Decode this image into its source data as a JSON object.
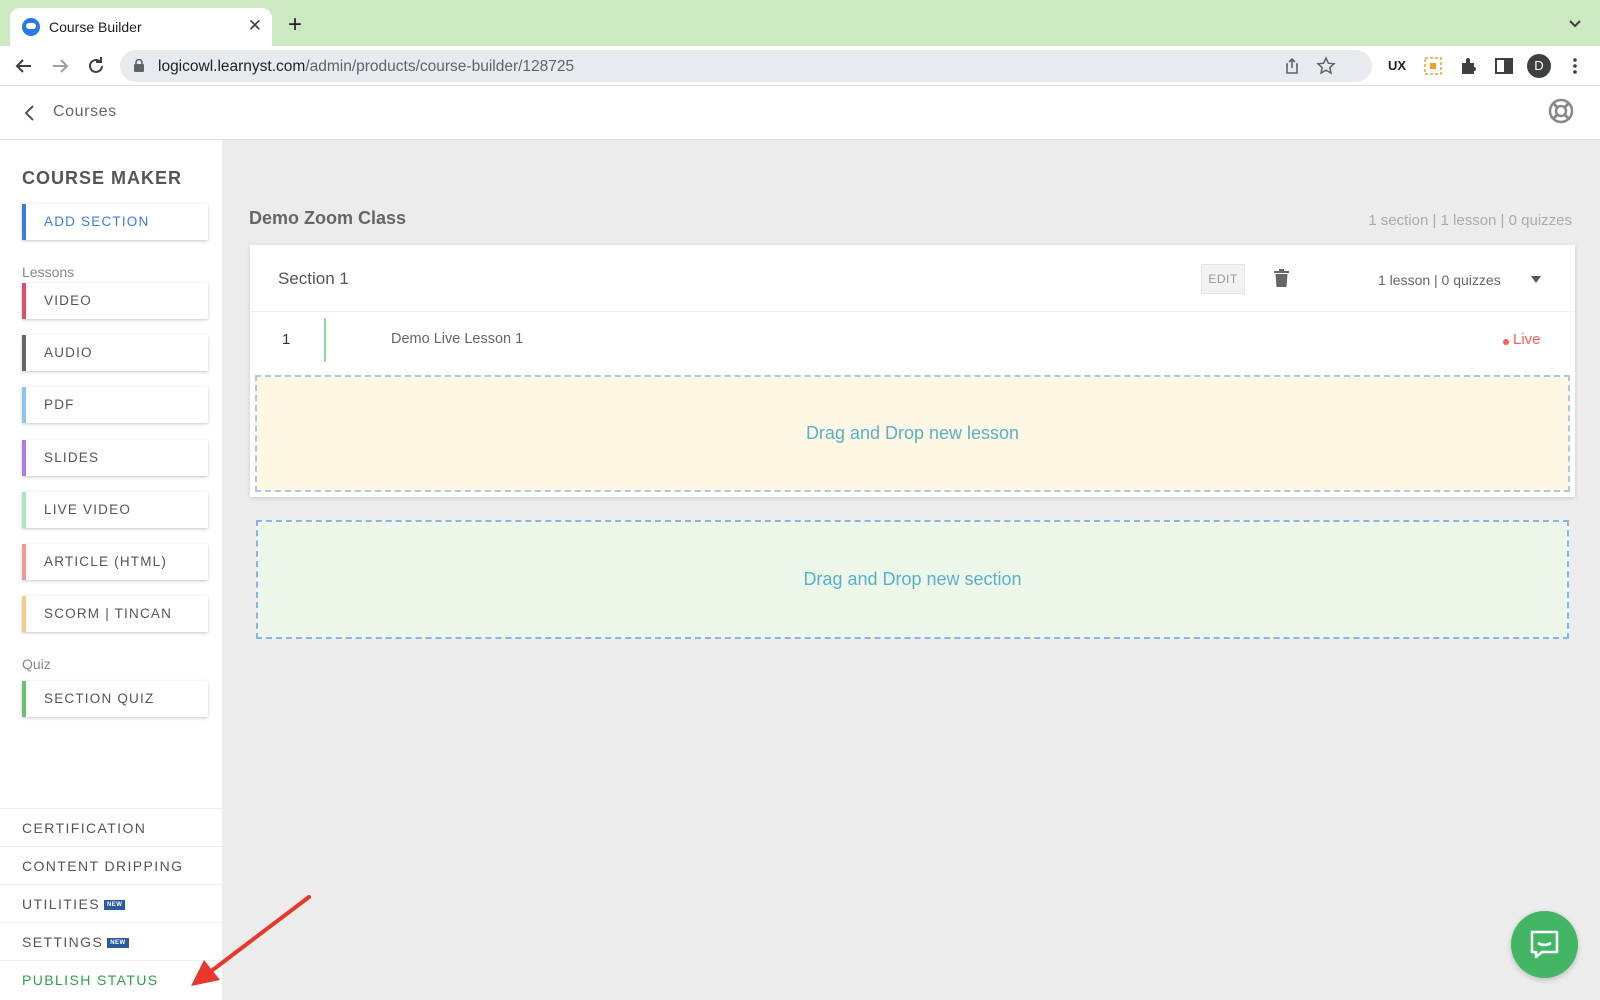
{
  "browser": {
    "tab_title": "Course Builder",
    "tab_close": "✕",
    "new_tab": "+",
    "url_host": "logicowl.learnyst.com",
    "url_path": "/admin/products/course-builder/128725",
    "profile_initial": "D",
    "ext_ux_label": "UX"
  },
  "header": {
    "breadcrumb": "Courses"
  },
  "sidebar": {
    "title": "COURSE MAKER",
    "add_section": "ADD SECTION",
    "lessons_label": "Lessons",
    "lesson_types": [
      {
        "label": "VIDEO",
        "color": "#e0506e"
      },
      {
        "label": "AUDIO",
        "color": "#666666"
      },
      {
        "label": "PDF",
        "color": "#8ec6ef"
      },
      {
        "label": "SLIDES",
        "color": "#b07ae6"
      },
      {
        "label": "LIVE VIDEO",
        "color": "#a8e6c0"
      },
      {
        "label": "ARTICLE (HTML)",
        "color": "#f09a9a"
      },
      {
        "label": "SCORM | TINCAN",
        "color": "#f7cc8a"
      }
    ],
    "quiz_label": "Quiz",
    "section_quiz": "SECTION QUIZ",
    "bottom_items": [
      {
        "label": "CERTIFICATION"
      },
      {
        "label": "CONTENT DRIPPING"
      },
      {
        "label": "UTILITIES",
        "badge": "NEW"
      },
      {
        "label": "SETTINGS",
        "badge": "NEW"
      },
      {
        "label": "PUBLISH STATUS",
        "color": "#2e9e4f"
      }
    ]
  },
  "course": {
    "title": "Demo Zoom Class",
    "stats": "1 section | 1 lesson | 0 quizzes"
  },
  "section": {
    "name": "Section 1",
    "edit_label": "EDIT",
    "stats": "1 lesson | 0 quizzes",
    "lessons": [
      {
        "number": "1",
        "title": "Demo Live Lesson 1",
        "status": "Live"
      }
    ],
    "drop_lesson": "Drag and Drop new lesson"
  },
  "drop_section": "Drag and Drop new section",
  "colors": {
    "accent_blue": "#3b7ddd",
    "live_red": "#ff5c5c",
    "publish_green": "#2e9e4f",
    "chat_green": "#43b665",
    "annotation_arrow": "#e8382e"
  }
}
